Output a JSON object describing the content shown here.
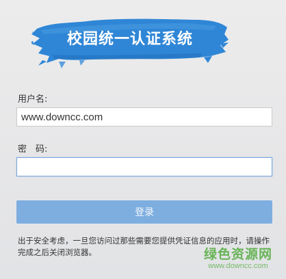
{
  "banner": {
    "title": "校园统一认证系统"
  },
  "form": {
    "username_label": "用户名:",
    "username_value": "www.downcc.com",
    "password_label": "密　码:",
    "password_value": "",
    "login_label": "登录"
  },
  "notice": "出于安全考虑，一旦您访问过那些需要您提供凭证信息的应用时，请操作完成之后关闭浏览器。",
  "watermark": {
    "logo": "绿色资源网",
    "url": "www.downcc.com"
  },
  "colors": {
    "banner": "#2f86d6",
    "button": "#7eaee0",
    "watermark": "#52ac3e"
  }
}
